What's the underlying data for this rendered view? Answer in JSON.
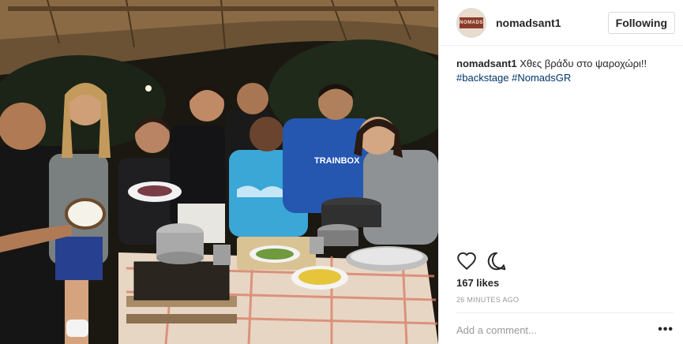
{
  "post": {
    "username": "nomadsant1",
    "avatar_text": "NOMADS",
    "follow_label": "Following",
    "caption": {
      "username": "nomadsant1",
      "text": "Χθες βράδυ στο ψαροχώρι!!",
      "hashtags": [
        "#backstage",
        "#NomadsGR"
      ]
    },
    "photo": {
      "shirt_text": "TRAINBOX"
    },
    "likes": "167 likes",
    "time": "26 MINUTES AGO",
    "comment_placeholder": "Add a comment...",
    "more_label": "•••",
    "icons": {
      "like": "heart-icon",
      "comment": "comment-icon",
      "more": "more-options-icon"
    },
    "colors": {
      "hashtag": "#003569",
      "border": "#efefef",
      "muted": "#999999"
    }
  }
}
